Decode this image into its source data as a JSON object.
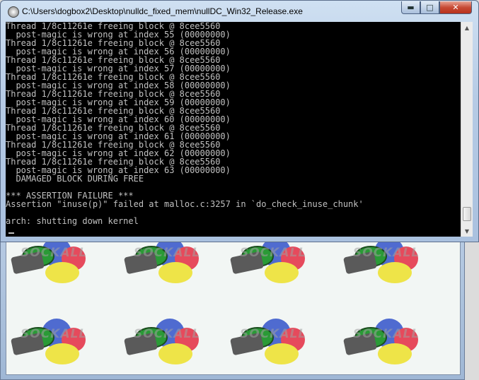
{
  "window": {
    "title": "C:\\Users\\dogbox2\\Desktop\\nulldc_fixed_mem\\nullDC_Win32_Release.exe",
    "app_icon": "console-app-icon",
    "controls": {
      "minimize": "minimize-icon",
      "maximize": "maximize-icon",
      "close": "close-icon"
    }
  },
  "console": {
    "lines": [
      "Thread 1/8c11261e freeing block @ 8cee5560",
      "  post-magic is wrong at index 55 (00000000)",
      "Thread 1/8c11261e freeing block @ 8cee5560",
      "  post-magic is wrong at index 56 (00000000)",
      "Thread 1/8c11261e freeing block @ 8cee5560",
      "  post-magic is wrong at index 57 (00000000)",
      "Thread 1/8c11261e freeing block @ 8cee5560",
      "  post-magic is wrong at index 58 (00000000)",
      "Thread 1/8c11261e freeing block @ 8cee5560",
      "  post-magic is wrong at index 59 (00000000)",
      "Thread 1/8c11261e freeing block @ 8cee5560",
      "  post-magic is wrong at index 60 (00000000)",
      "Thread 1/8c11261e freeing block @ 8cee5560",
      "  post-magic is wrong at index 61 (00000000)",
      "Thread 1/8c11261e freeing block @ 8cee5560",
      "  post-magic is wrong at index 62 (00000000)",
      "Thread 1/8c11261e freeing block @ 8cee5560",
      "  post-magic is wrong at index 63 (00000000)",
      "  DAMAGED BLOCK DURING FREE",
      "",
      "*** ASSERTION FAILURE ***",
      "Assertion \"inuse(p)\" failed at malloc.c:3257 in `do_check_inuse_chunk'",
      "",
      "arch: shutting down kernel"
    ],
    "text_color": "#c0c0c0",
    "background": "#000000"
  },
  "background_window": {
    "logo_text": "SOCKALL",
    "logo_colors": {
      "blue": "#4f6bd0",
      "red": "#e64a5c",
      "yellow": "#eee448",
      "green": "#2a9a36"
    }
  }
}
